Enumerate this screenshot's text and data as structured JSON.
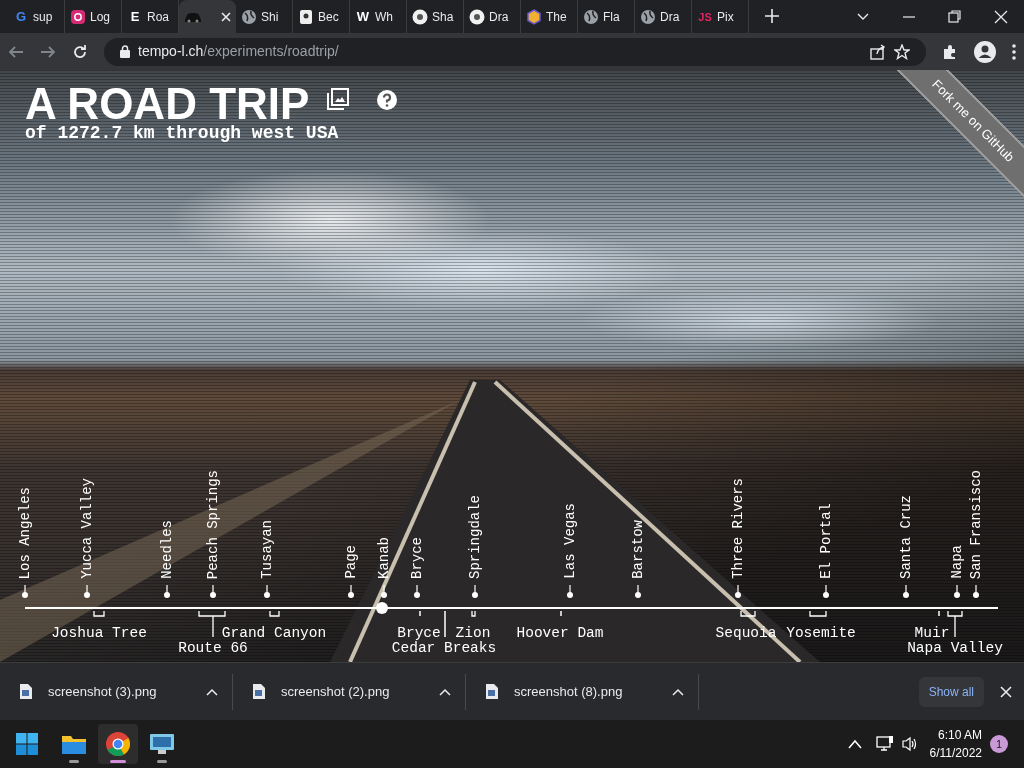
{
  "tabs": [
    {
      "label": "sup",
      "selected": false,
      "favicon": {
        "kind": "letter",
        "text": "G",
        "color": "#4285f4"
      }
    },
    {
      "label": "Log",
      "selected": false,
      "favicon": {
        "kind": "camera"
      }
    },
    {
      "label": "Roa",
      "selected": false,
      "favicon": {
        "kind": "letter",
        "text": "E",
        "color": "#ffffff"
      }
    },
    {
      "selected": true,
      "favicon": {
        "kind": "car"
      }
    },
    {
      "label": "Shi",
      "selected": false,
      "favicon": {
        "kind": "globe"
      }
    },
    {
      "label": "Bec",
      "selected": false,
      "favicon": {
        "kind": "square"
      }
    },
    {
      "label": "Wh",
      "selected": false,
      "favicon": {
        "kind": "letter",
        "text": "W",
        "color": "#ffffff"
      }
    },
    {
      "label": "Sha",
      "selected": false,
      "favicon": {
        "kind": "disc"
      }
    },
    {
      "label": "Dra",
      "selected": false,
      "favicon": {
        "kind": "disc"
      }
    },
    {
      "label": "The",
      "selected": false,
      "favicon": {
        "kind": "hexagon"
      }
    },
    {
      "label": "Fla",
      "selected": false,
      "favicon": {
        "kind": "globe"
      }
    },
    {
      "label": "Dra",
      "selected": false,
      "favicon": {
        "kind": "globe"
      }
    },
    {
      "label": "Pix",
      "selected": false,
      "favicon": {
        "kind": "letter",
        "text": "JS",
        "color": "#e0245e"
      }
    }
  ],
  "address_bar": {
    "host": "tempo-l.ch",
    "path": "/experiments/roadtrip/"
  },
  "page": {
    "title": "A ROAD TRIP",
    "subtitle": "of 1272.7 km through west USA",
    "ribbon": "Fork me on GitHub",
    "timeline": {
      "level": 0.367,
      "stops": [
        "Los Angeles",
        "Yucca Valley",
        "Needles",
        "Peach Springs",
        "Tusayan",
        "Page",
        "Kanab",
        "Bryce",
        "Springdale",
        "Las Vegas",
        "Barstow",
        "Three Rivers",
        "El Portal",
        "Santa Cruz",
        "Napa",
        "San Fransisco"
      ],
      "sights": [
        "Joshua Tree",
        "Grand Canyon",
        "Bryce",
        "Zion",
        "Hoover Dam",
        "Sequoia",
        "Yosemite",
        "Muir",
        "Route 66",
        "Cedar Breaks",
        "Napa Valley"
      ]
    }
  },
  "downloads": {
    "files": [
      "screenshot (3).png",
      "screenshot (2).png",
      "screenshot (8).png"
    ],
    "show_all": "Show all"
  },
  "taskbar": {
    "apps": [
      {
        "kind": "folder",
        "selected": false
      },
      {
        "kind": "chrome",
        "selected": true
      },
      {
        "kind": "monitor",
        "selected": false
      }
    ],
    "time": "6:10 AM",
    "date": "6/11/2022",
    "notifications": "1"
  }
}
